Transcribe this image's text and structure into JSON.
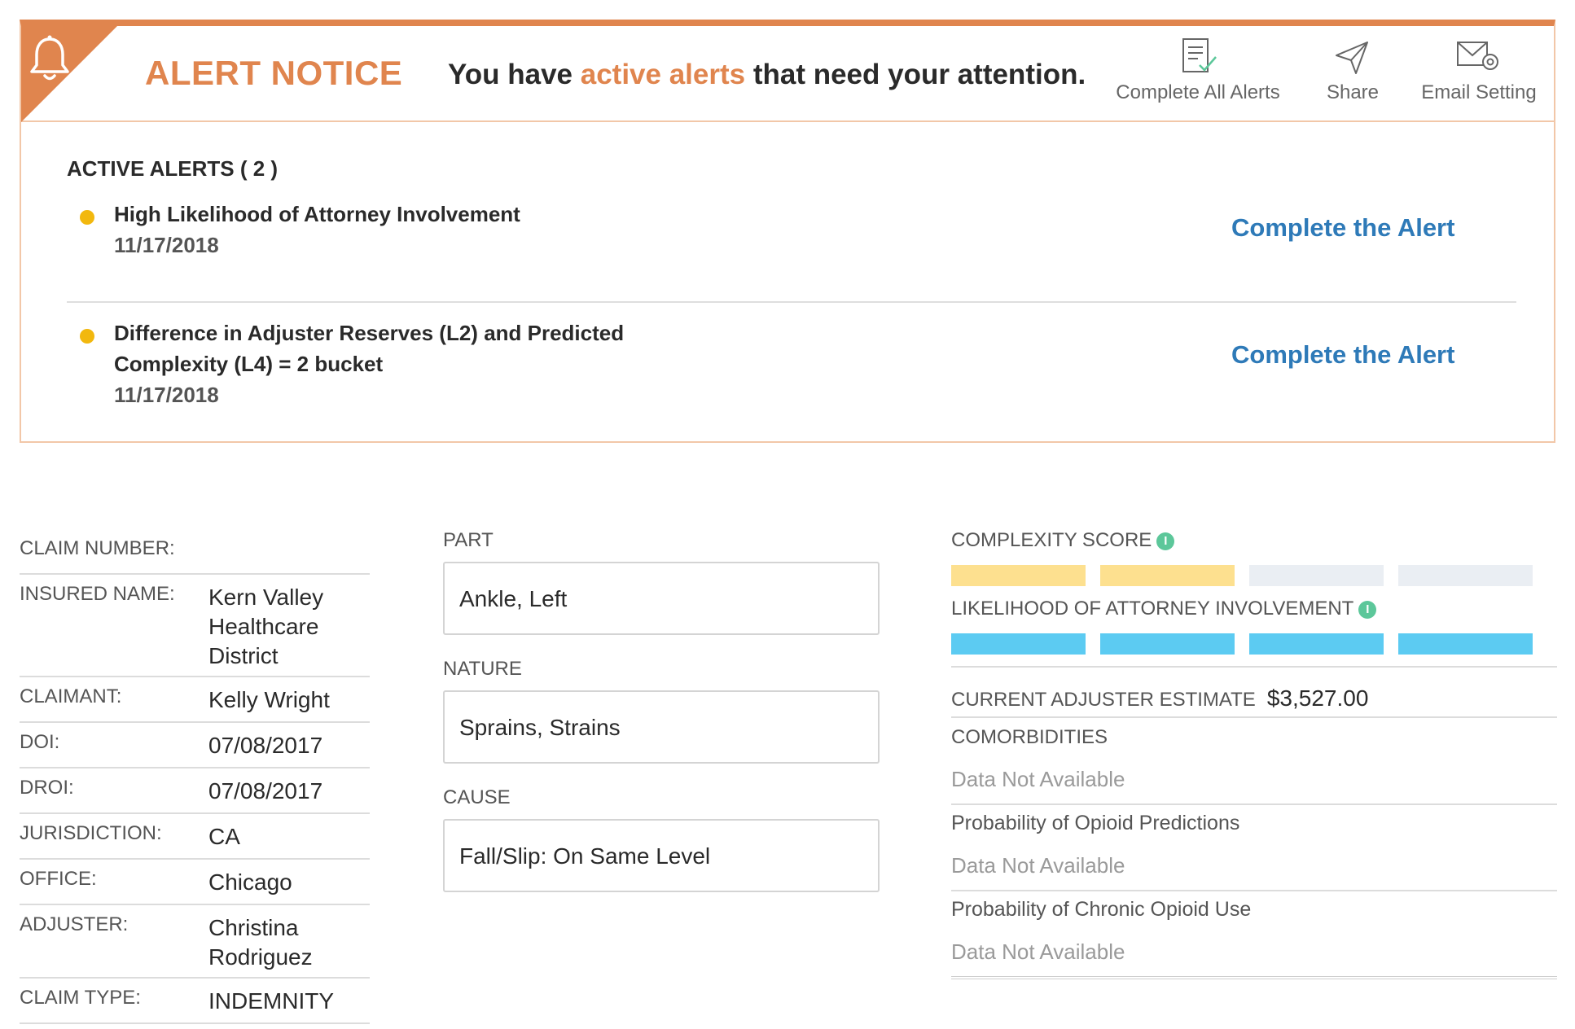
{
  "alert": {
    "title": "ALERT NOTICE",
    "message_prefix": "You have ",
    "message_accent": "active alerts",
    "message_suffix": " that need your attention.",
    "accent_color": "#e0854e",
    "actions": {
      "complete_all": "Complete All Alerts",
      "share": "Share",
      "email_setting": "Email Setting"
    },
    "active_title": "ACTIVE ALERTS ( 2 )",
    "items": [
      {
        "line1": "High Likelihood of Attorney Involvement",
        "line2": "",
        "date": "11/17/2018",
        "action": "Complete the Alert"
      },
      {
        "line1": "Difference in Adjuster Reserves (L2) and Predicted",
        "line2": "Complexity (L4) = 2 bucket",
        "date": "11/17/2018",
        "action": "Complete the Alert"
      }
    ]
  },
  "claim": {
    "rows": [
      {
        "label": "CLAIM NUMBER:",
        "value": ""
      },
      {
        "label": "INSURED NAME:",
        "value": "Kern Valley Healthcare District"
      },
      {
        "label": "CLAIMANT:",
        "value": "Kelly Wright"
      },
      {
        "label": "DOI:",
        "value": "07/08/2017"
      },
      {
        "label": "DROI:",
        "value": "07/08/2017"
      },
      {
        "label": "JURISDICTION:",
        "value": "CA"
      },
      {
        "label": "OFFICE:",
        "value": "Chicago"
      },
      {
        "label": "ADJUSTER:",
        "value": "Christina Rodriguez"
      },
      {
        "label": "CLAIM TYPE:",
        "value": "INDEMNITY"
      }
    ]
  },
  "injury": {
    "part_label": "PART",
    "part_value": "Ankle, Left",
    "nature_label": "NATURE",
    "nature_value": "Sprains, Strains",
    "cause_label": "CAUSE",
    "cause_value": "Fall/Slip: On Same Level"
  },
  "scores": {
    "complexity_label": "COMPLEXITY SCORE",
    "complexity_level": 2,
    "complexity_total": 4,
    "complexity_color": "#fde08f",
    "attorney_label": "LIKELIHOOD OF ATTORNEY INVOLVEMENT",
    "attorney_level": 4,
    "attorney_total": 4,
    "attorney_color": "#5ccbf2",
    "empty_color": "#eaeef3",
    "info_glyph": "i",
    "estimate_label": "CURRENT ADJUSTER ESTIMATE",
    "estimate_value": "$3,527.00",
    "comorbidities_label": "COMORBIDITIES",
    "comorbidities_value": "Data Not Available",
    "opioid_pred_label": "Probability of Opioid Predictions",
    "opioid_pred_value": "Data Not Available",
    "chronic_opioid_label": "Probability of Chronic Opioid Use",
    "chronic_opioid_value": "Data Not Available"
  }
}
